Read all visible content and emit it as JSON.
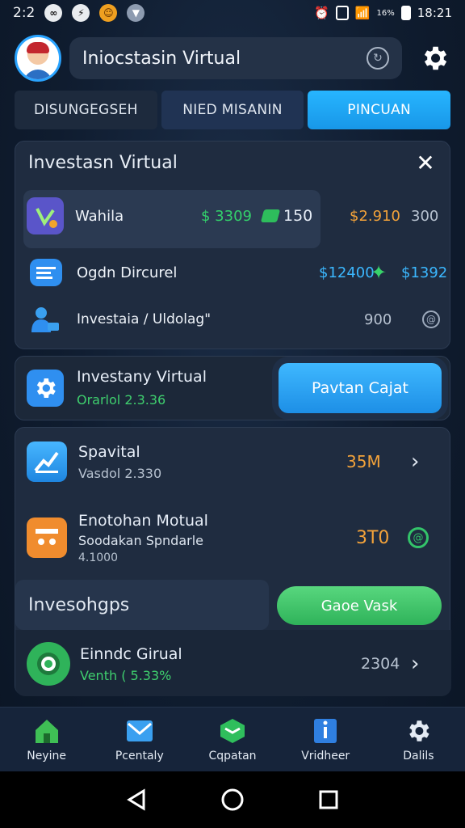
{
  "status_bar": {
    "time_left": "2:2",
    "time_right": "18:21",
    "battery_text": "16%",
    "icons": [
      "app-icon",
      "app-icon",
      "emoji-icon",
      "shield-icon",
      "alarm-icon",
      "wifi-icon",
      "signal-icon",
      "battery-icon"
    ]
  },
  "header": {
    "search_value": "Iniocstasin Virtual"
  },
  "tabs": [
    {
      "label": "DISUNGEGSEH"
    },
    {
      "label": "NIED MISANIN"
    },
    {
      "label": "PINCUAN"
    }
  ],
  "card1": {
    "title": "Investasn Virtual",
    "rows": [
      {
        "label": "Wahila",
        "amount": "$ 3309",
        "badge_value": "150",
        "price": "$2.910",
        "count": "300"
      },
      {
        "label": "Ogdn Dircurel",
        "amount": "$12400",
        "price": "$1392"
      },
      {
        "label": "Investaia / Uldolag\"",
        "count": "900"
      }
    ]
  },
  "card2": {
    "title": "Investany Virtual",
    "subtitle": "Orarlol 2.3.36",
    "button": "Pavtan Cajat"
  },
  "card3": {
    "rows": [
      {
        "title": "Spavital",
        "subtitle": "Vasdol 2.330",
        "value": "35M"
      },
      {
        "title": "Enotohan Motual",
        "subtitle": "Soodakan Spndarle",
        "sub2": "4.1000",
        "value": "3T0"
      }
    ],
    "section_label": "Invesohgps",
    "green_button": "Gaoe Vask",
    "last_row": {
      "title": "Einndc Girual",
      "subtitle": "Venth ( 5.33%",
      "value": "2304"
    }
  },
  "bottom_nav": [
    {
      "label": "Neyine",
      "icon": "home-icon",
      "color": "#3fbf55"
    },
    {
      "label": "Pcentaly",
      "icon": "mail-icon",
      "color": "#3aa0f0"
    },
    {
      "label": "Cqpatan",
      "icon": "cube-icon",
      "color": "#2fbe5c"
    },
    {
      "label": "Vridheer",
      "icon": "info-book-icon",
      "color": "#2f7fe0"
    },
    {
      "label": "Dalils",
      "icon": "gear-icon",
      "color": "#e4ebf4"
    }
  ]
}
